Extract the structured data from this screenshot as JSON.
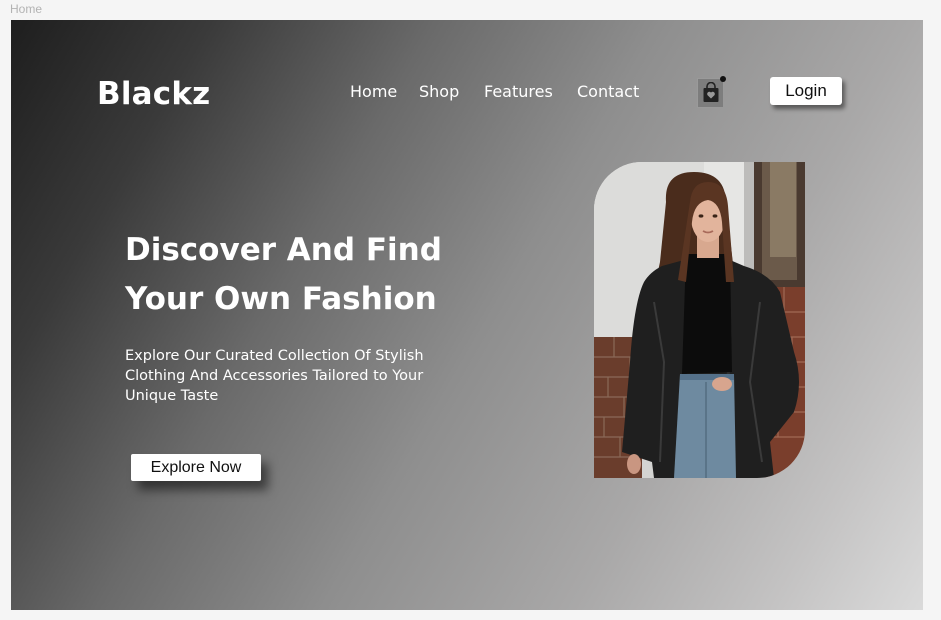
{
  "frame": {
    "label": "Home"
  },
  "brand": {
    "logo": "Blackz"
  },
  "nav": {
    "items": [
      {
        "label": "Home"
      },
      {
        "label": "Shop"
      },
      {
        "label": "Features"
      },
      {
        "label": "Contact"
      }
    ],
    "cart_icon": "shopping-bag-heart-icon",
    "login_label": "Login"
  },
  "hero": {
    "headline_line1": "Discover And Find",
    "headline_line2": "Your Own Fashion",
    "subtext_line1": "Explore Our Curated Collection Of Stylish",
    "subtext_line2": "Clothing And Accessories Tailored to Your",
    "subtext_line3": "Unique Taste",
    "cta_label": "Explore Now",
    "image": "woman-in-black-leather-coat-photo"
  },
  "colors": {
    "text": "#ffffff",
    "button_bg": "#ffffff",
    "gradient_dark": "#1e1e1e",
    "gradient_light": "#dadada"
  }
}
